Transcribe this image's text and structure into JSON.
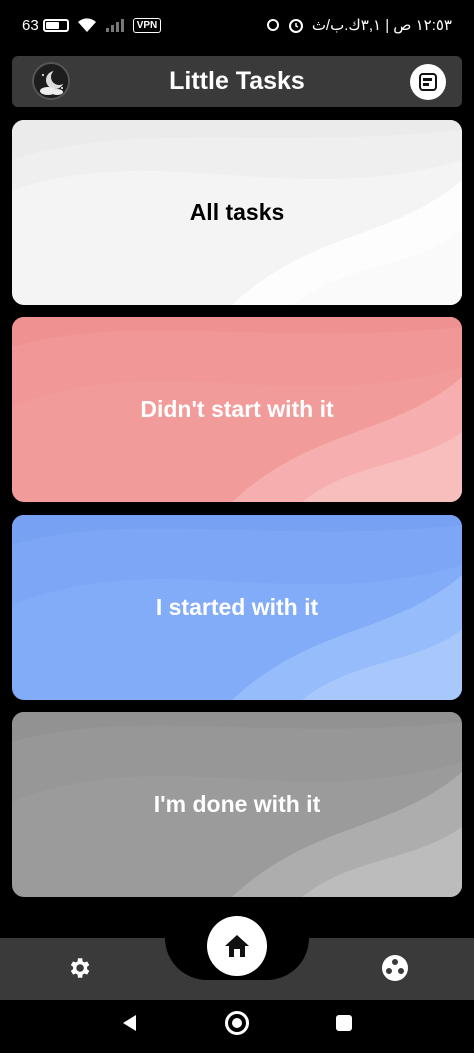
{
  "status_bar": {
    "battery": "63",
    "vpn": "VPN",
    "time": "١٢:٥٣ ص | ٣,١ك.ب/ث"
  },
  "header": {
    "title": "Little Tasks",
    "left_icon": "moon-avatar-icon",
    "right_icon": "note-icon"
  },
  "cards": [
    {
      "label": "All tasks",
      "bg": "#f4f4f4",
      "text_color": "#000000"
    },
    {
      "label": "Didn't start with it",
      "bg": "#f29b9b",
      "text_color": "#ffffff"
    },
    {
      "label": "I started with it",
      "bg": "#82abf8",
      "text_color": "#ffffff"
    },
    {
      "label": "I'm done with it",
      "bg": "#9b9b9b",
      "text_color": "#ffffff"
    }
  ],
  "bottom_nav": {
    "left_icon": "gear-icon",
    "center_icon": "home-icon",
    "right_icon": "game-icon"
  },
  "system_nav": {
    "back": "back-icon",
    "home": "home-circle-icon",
    "recent": "recent-apps-icon"
  }
}
